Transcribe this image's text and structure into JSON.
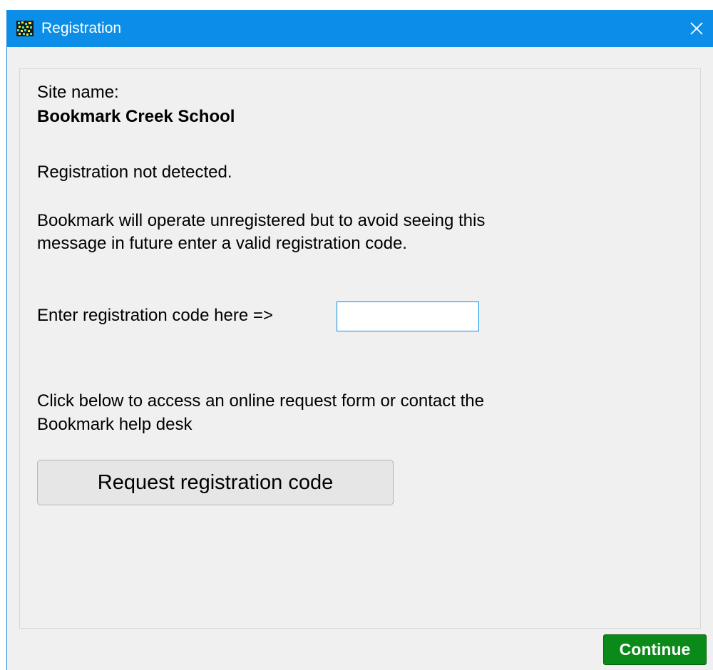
{
  "window": {
    "title": "Registration",
    "icon": "bookmark-app-icon",
    "close_icon": "close-icon"
  },
  "site": {
    "label": "Site name:",
    "name": "Bookmark Creek School"
  },
  "status_text": "Registration not detected.",
  "info": {
    "line1": "Bookmark will operate unregistered but to avoid seeing this",
    "line2": "message in future enter a valid registration code."
  },
  "code_entry": {
    "label": "Enter registration code here =>",
    "value": "",
    "placeholder": ""
  },
  "request": {
    "line1": "Click below to access an online request form or contact the",
    "line2": "Bookmark help desk",
    "button_label": "Request registration code"
  },
  "footer": {
    "continue_label": "Continue"
  },
  "colors": {
    "titlebar": "#0c8ee8",
    "window_bg": "#f0f0f0",
    "continue_bg": "#0a8a18",
    "input_border": "#0c8ee8"
  }
}
